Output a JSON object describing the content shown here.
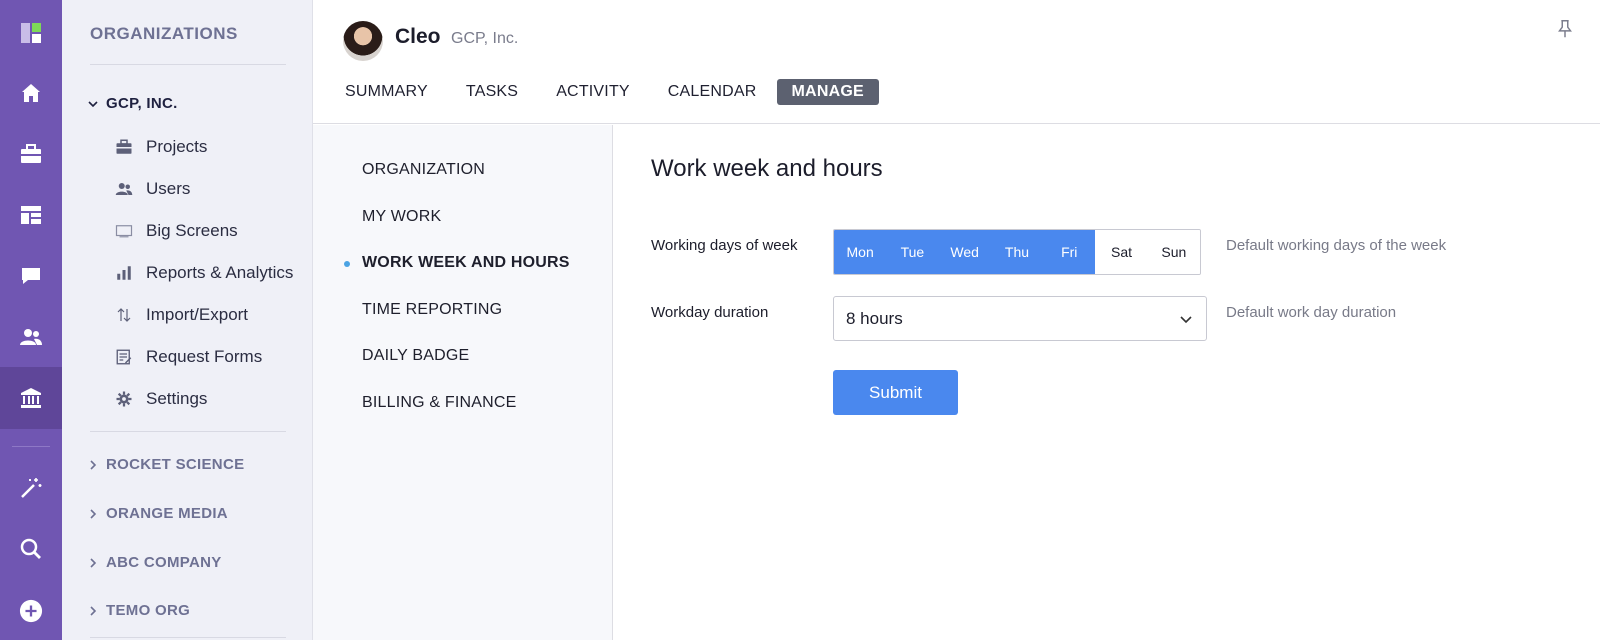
{
  "sidebar": {
    "title": "ORGANIZATIONS",
    "current_org": "GCP, INC.",
    "items": [
      {
        "label": "Projects",
        "icon": "briefcase-icon"
      },
      {
        "label": "Users",
        "icon": "users-icon"
      },
      {
        "label": "Big Screens",
        "icon": "screen-icon"
      },
      {
        "label": "Reports & Analytics",
        "icon": "bar-chart-icon"
      },
      {
        "label": "Import/Export",
        "icon": "import-export-icon"
      },
      {
        "label": "Request Forms",
        "icon": "form-icon"
      },
      {
        "label": "Settings",
        "icon": "gear-icon"
      }
    ],
    "other_orgs": [
      "ROCKET SCIENCE",
      "ORANGE MEDIA",
      "ABC COMPANY",
      "TEMO ORG"
    ]
  },
  "rail": {
    "icons": [
      "logo-icon",
      "home-icon",
      "briefcase-icon",
      "dashboard-icon",
      "chat-icon",
      "users-icon",
      "bank-icon",
      "magic-wand-icon",
      "search-icon",
      "plus-icon"
    ]
  },
  "header": {
    "user_name": "Cleo",
    "user_org": "GCP, Inc.",
    "tabs": [
      "SUMMARY",
      "TASKS",
      "ACTIVITY",
      "CALENDAR",
      "MANAGE"
    ],
    "active_tab": "MANAGE"
  },
  "submenu": {
    "items": [
      "ORGANIZATION",
      "MY WORK",
      "WORK WEEK AND HOURS",
      "TIME REPORTING",
      "DAILY BADGE",
      "BILLING & FINANCE"
    ],
    "active": "WORK WEEK AND HOURS"
  },
  "content": {
    "title": "Work week and hours",
    "working_days_label": "Working days of week",
    "days": [
      {
        "label": "Mon",
        "selected": true
      },
      {
        "label": "Tue",
        "selected": true
      },
      {
        "label": "Wed",
        "selected": true
      },
      {
        "label": "Thu",
        "selected": true
      },
      {
        "label": "Fri",
        "selected": true
      },
      {
        "label": "Sat",
        "selected": false
      },
      {
        "label": "Sun",
        "selected": false
      }
    ],
    "working_days_hint": "Default working days of the week",
    "duration_label": "Workday duration",
    "duration_value": "8 hours",
    "duration_hint": "Default work day duration",
    "submit_label": "Submit"
  },
  "colors": {
    "rail": "#7056b2",
    "accent": "#4a88ee",
    "active_tab": "#5c6170"
  }
}
